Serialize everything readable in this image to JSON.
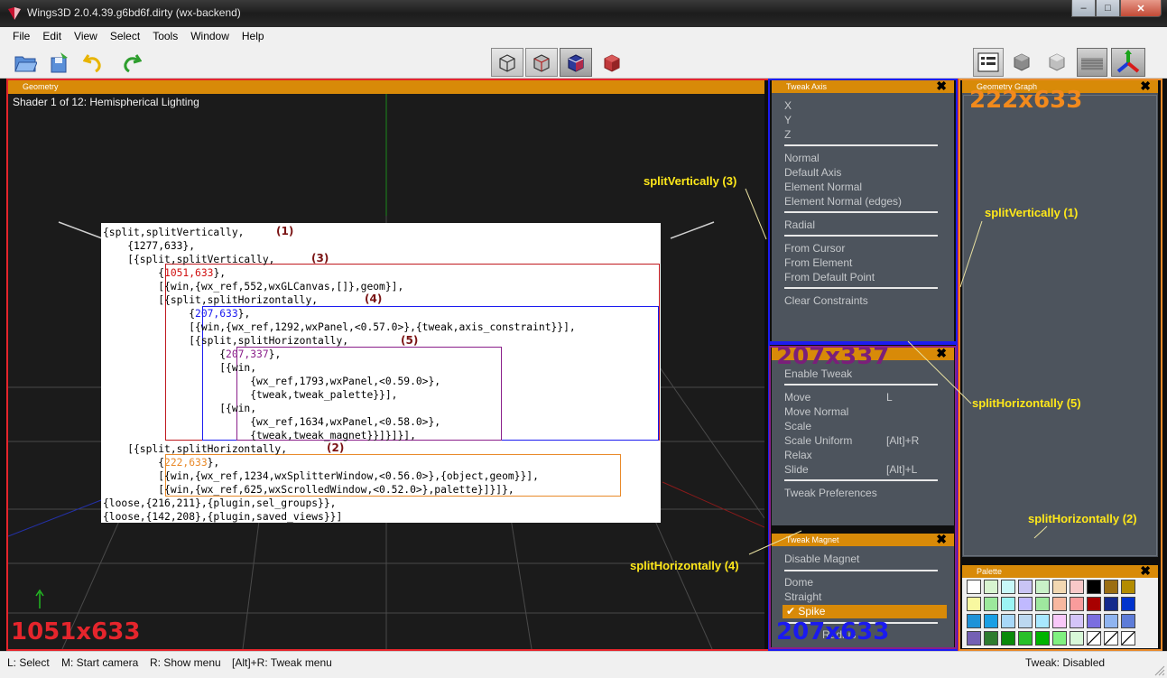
{
  "window": {
    "title": "Wings3D 2.0.4.39.g6bd6f.dirty (wx-backend)"
  },
  "menu": [
    "File",
    "Edit",
    "View",
    "Select",
    "Tools",
    "Window",
    "Help"
  ],
  "toolbar": {
    "left": [
      "open-icon",
      "save-icon",
      "undo-icon",
      "redo-icon"
    ],
    "center": [
      "wireframe-cube-icon",
      "shaded-wire-cube-icon",
      "smooth-cube-blue-icon",
      "solid-cube-red-icon"
    ],
    "right": [
      "outliner-icon",
      "solid-shape-icon",
      "light-shape-icon",
      "ground-grid-icon",
      "axes-icon"
    ]
  },
  "geometry": {
    "header": "Geometry",
    "shader": "Shader 1 of 12: Hemispherical Lighting",
    "size_label": "1051x633"
  },
  "tweak_axis": {
    "header": "Tweak Axis",
    "items": [
      "X",
      "Y",
      "Z",
      "Normal",
      "Default Axis",
      "Element Normal",
      "Element Normal (edges)",
      "Radial",
      "From Cursor",
      "From Element",
      "From Default Point",
      "Clear Constraints"
    ]
  },
  "tweak_palette": {
    "size_label": "207x337",
    "items": [
      {
        "label": "Enable Tweak",
        "key": ""
      },
      {
        "label": "Move",
        "key": "L"
      },
      {
        "label": "Move Normal",
        "key": ""
      },
      {
        "label": "Scale",
        "key": ""
      },
      {
        "label": "Scale Uniform",
        "key": "[Alt]+R"
      },
      {
        "label": "Relax",
        "key": ""
      },
      {
        "label": "Slide",
        "key": "[Alt]+L"
      },
      {
        "label": "Tweak Preferences",
        "key": ""
      }
    ]
  },
  "tweak_magnet": {
    "header": "Tweak Magnet",
    "items": [
      "Disable Magnet",
      "Dome",
      "Straight",
      "Spike"
    ],
    "selected": "Spike",
    "partial": "Radius",
    "size_label": "207x633"
  },
  "geometry_graph": {
    "header": "Geometry Graph",
    "size_label": "222x633"
  },
  "palette": {
    "header": "Palette",
    "colors": [
      "#ffffff",
      "#d8f4d0",
      "#c8f8f8",
      "#c9c4f4",
      "#c9f1c8",
      "#f2d8b2",
      "#f8c8c8",
      "#000000",
      "#9b6e12",
      "#b38c00",
      "#f8f8a0",
      "#9ce89c",
      "#9cf4f4",
      "#c0b9ff",
      "#9fe89f",
      "#f8b8a0",
      "#f99c9c",
      "#a80000",
      "#142a8c",
      "#0033cc",
      "#1e93d8",
      "#1a9fe4",
      "#a8d8f8",
      "#bcd8f0",
      "#a8e8ff",
      "#f8c8f8",
      "#d4c4f8",
      "#7a6ee0",
      "#8fb4f0",
      "#5e7cd8",
      "#7460b4",
      "#2e7c2e",
      "#0a8a0a",
      "#28c028",
      "#00b400",
      "#80f080",
      "#d8f8d8",
      "#ffffff",
      "#ffffff",
      "#ffffff"
    ],
    "empty_from": 37
  },
  "annotations": {
    "sv3": "splitVertically (3)",
    "sv1": "splitVertically (1)",
    "sh5": "splitHorizontally (5)",
    "sh2": "splitHorizontally (2)",
    "sh4": "splitHorizontally (4)"
  },
  "code": {
    "lines": [
      "{split,splitVertically,",
      "    {1277,633},",
      "    [{split,splitVertically,",
      "         {1051,633},",
      "         [{win,{wx_ref,552,wxGLCanvas,[]},geom}],",
      "         [{split,splitHorizontally,",
      "              {207,633},",
      "              [{win,{wx_ref,1292,wxPanel,<0.57.0>},{tweak,axis_constraint}}],",
      "              [{split,splitHorizontally,",
      "                   {207,337},",
      "                   [{win,",
      "                        {wx_ref,1793,wxPanel,<0.59.0>},",
      "                        {tweak,tweak_palette}}],",
      "                   [{win,",
      "                        {wx_ref,1634,wxPanel,<0.58.0>},",
      "                        {tweak,tweak_magnet}}]}]}],",
      "    [{split,splitHorizontally,",
      "         {222,633},",
      "         [{win,{wx_ref,1234,wxSplitterWindow,<0.56.0>},{object,geom}}],",
      "         [{win,{wx_ref,625,wxScrolledWindow,<0.52.0>},palette}]}]},",
      "{loose,{216,211},{plugin,sel_groups}},",
      "{loose,{142,208},{plugin,saved_views}}]"
    ],
    "markers": [
      "(1)",
      "(3)",
      "(4)",
      "(5)",
      "(2)"
    ]
  },
  "status": {
    "left": [
      "L: Select",
      "M: Start camera",
      "R: Show menu",
      "[Alt]+R: Tweak menu"
    ],
    "right": "Tweak: Disabled"
  },
  "colors": {
    "accent": "#d88a08",
    "panel": "#4d545d",
    "red_box": "#e5252c",
    "blue_box": "#1c1cf0",
    "purple_box": "#8a1f8a",
    "orange_box": "#e98a2a",
    "annotation": "#ffe81a"
  }
}
